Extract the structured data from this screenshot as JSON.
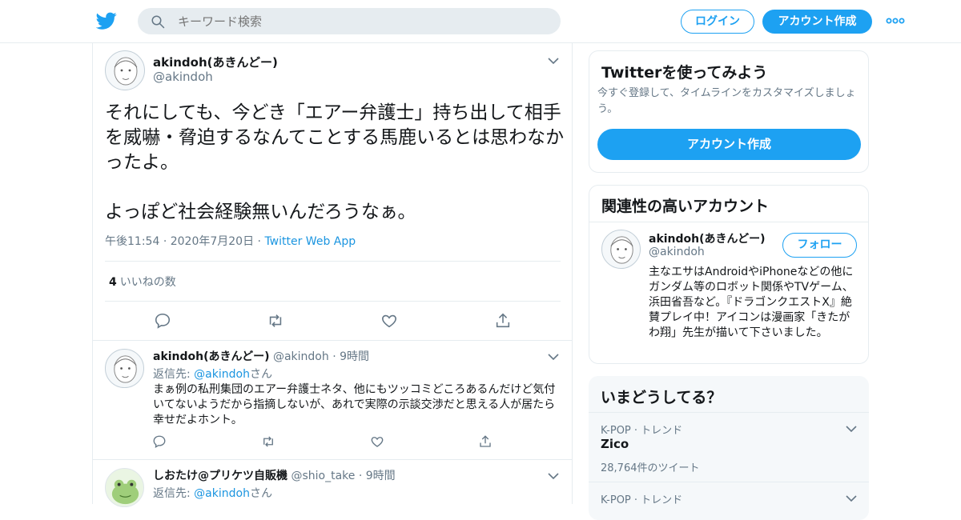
{
  "search": {
    "placeholder": "キーワード検索"
  },
  "header": {
    "login_label": "ログイン",
    "signup_label": "アカウント作成"
  },
  "main_tweet": {
    "name": "akindoh(あきんどー)",
    "handle": "@akindoh",
    "text": "それにしても、今どき「エアー弁護士」持ち出して相手を威嚇・脅迫するなんてことする馬鹿いるとは思わなかったよ。\n\nよっぽど社会経験無いんだろうなぁ。",
    "time": "午後11:54",
    "date": "2020年7月20日",
    "source": "Twitter Web App",
    "like_count": "4",
    "like_label": "いいねの数"
  },
  "replies": [
    {
      "name": "akindoh(あきんどー)",
      "handle": "@akindoh",
      "time": "9時間",
      "reply_prefix": "返信先: ",
      "reply_to": "@akindoh",
      "reply_suffix": "さん",
      "text": "まぁ例の私刑集団のエアー弁護士ネタ、他にもツッコミどころあるんだけど気付いてないようだから指摘しないが、あれで実際の示談交渉だと思える人が居たら幸せだよホント。"
    },
    {
      "name": "しおたけ@プリケツ自販機",
      "handle": "@shio_take",
      "time": "9時間",
      "reply_prefix": "返信先: ",
      "reply_to": "@akindoh",
      "reply_suffix": "さん"
    }
  ],
  "sidebar": {
    "try_card": {
      "title": "Twitterを使ってみよう",
      "subtitle": "今すぐ登録して、タイムラインをカスタマイズしましょう。",
      "button": "アカウント作成"
    },
    "related_card": {
      "title": "関連性の高いアカウント",
      "name": "akindoh(あきんどー)",
      "handle": "@akindoh",
      "follow_label": "フォロー",
      "bio": "主なエサはAndroidやiPhoneなどの他にガンダム等のロボット関係やTVゲーム、浜田省吾など。『ドラゴンクエストX』絶賛プレイ中！アイコンは漫画家「きたがわ翔」先生が描いて下さいました。"
    },
    "trends_card": {
      "title": "いまどうしてる？",
      "trends": [
        {
          "category": "K-POP · トレンド",
          "name": "Zico",
          "count": "28,764件のツイート"
        },
        {
          "category": "K-POP · トレンド"
        }
      ]
    }
  },
  "colors": {
    "accent": "#1da1f2",
    "link": "#1b95e0",
    "muted": "#657786",
    "border": "#e6ecf0"
  }
}
